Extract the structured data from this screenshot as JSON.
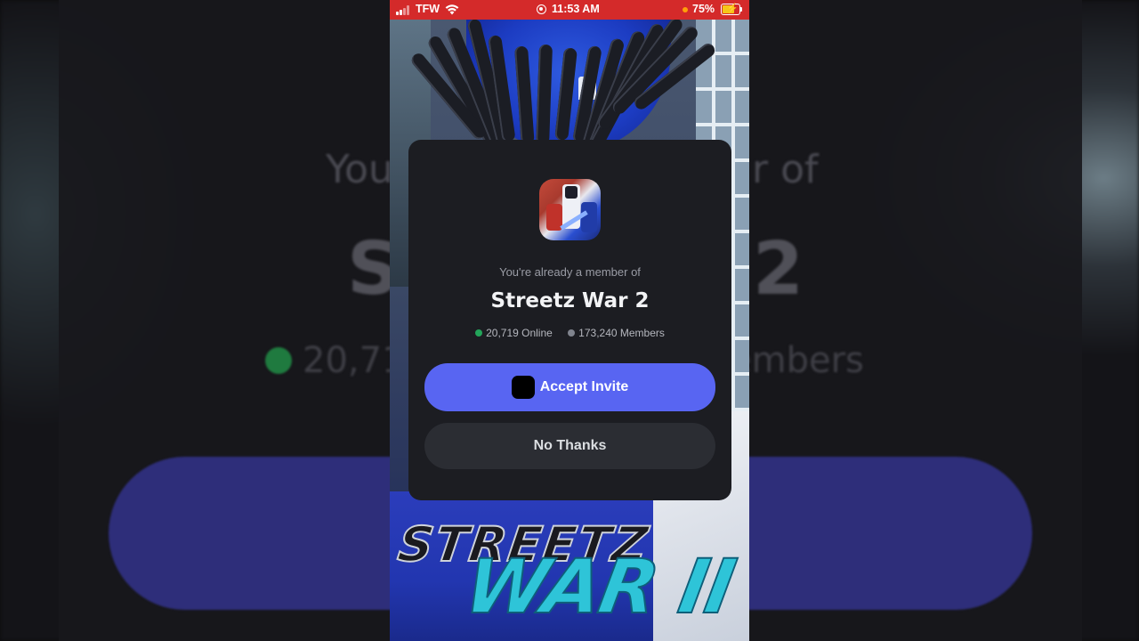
{
  "background_echo": {
    "subtitle_left": "You",
    "subtitle_right": "r of",
    "title_left": "S",
    "title_right": "2",
    "stat_left": "20,719",
    "stat_right": "embers"
  },
  "status_bar": {
    "carrier": "TFW",
    "time": "11:53 AM",
    "battery": "75%",
    "battery_level": 0.75,
    "battery_color": "#f5c518",
    "bar_color": "#d42a2a"
  },
  "game_art": {
    "logo_line1": "STREETZ",
    "logo_line2": "WAR II"
  },
  "invite": {
    "subtitle": "You're already a member of",
    "server_name": "Streetz War 2",
    "online": "20,719 Online",
    "members": "173,240 Members",
    "accept_label": "Accept Invite",
    "decline_label": "No Thanks",
    "accent_color": "#5865f2",
    "online_color": "#23a55a"
  }
}
